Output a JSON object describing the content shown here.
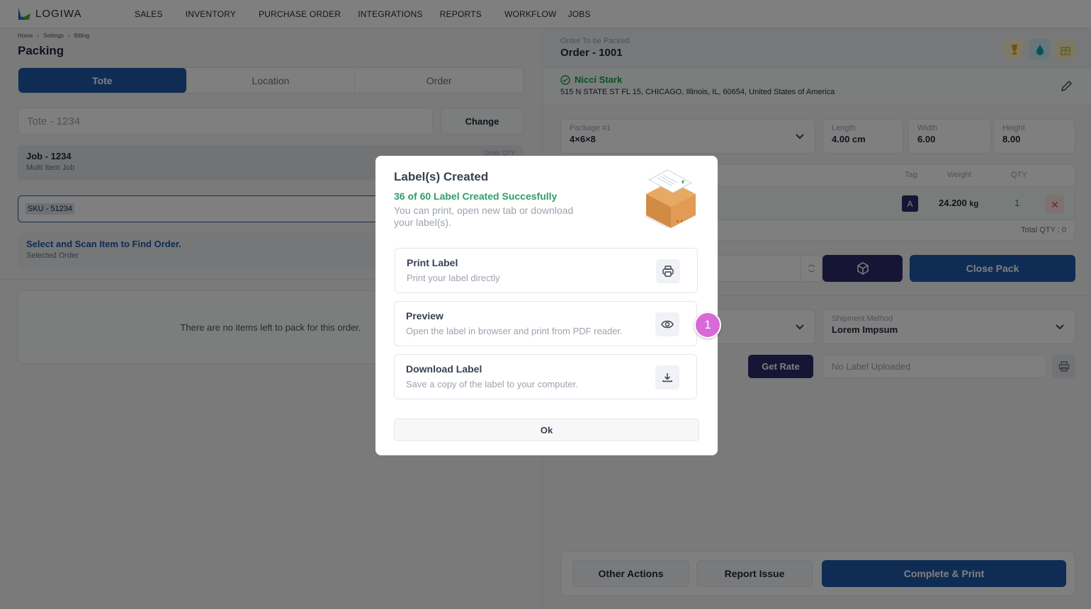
{
  "app": {
    "logo_text": "LOGIWA",
    "nav": [
      "SALES",
      "INVENTORY",
      "PURCHASE ORDER",
      "INTEGRATIONS",
      "REPORTS",
      "WORKFLOW",
      "JOBS"
    ]
  },
  "left": {
    "breadcrumb": [
      "Home",
      "Settings",
      "Billing"
    ],
    "page_title": "Packing",
    "tabs": [
      {
        "label": "Tote",
        "active": true
      },
      {
        "label": "Location",
        "active": false
      },
      {
        "label": "Order",
        "active": false
      }
    ],
    "tote_input_value": "Tote - 1234",
    "change_label": "Change",
    "job": {
      "title": "Job - 1234",
      "subtitle": "Multi Item Job",
      "qty_label": "Order QTY"
    },
    "sku_value": "SKU - 51234",
    "scan": {
      "title": "Select and Scan Item to Find Order.",
      "subtitle": "Selected Order"
    },
    "empty_message": "There are no items left to pack for this order."
  },
  "right": {
    "order_label": "Order To be Packed",
    "order_number": "Order - 1001",
    "badges": [
      {
        "icon": "fragile-glass-icon",
        "color": "#e0a800"
      },
      {
        "icon": "water-drop-icon",
        "color": "#14b8c4"
      },
      {
        "icon": "gift-icon",
        "color": "#d4c44a"
      }
    ],
    "customer_name": "Nicci Stark",
    "customer_address": "515 N STATE ST FL 15, CHICAGO, Illinois, IL, 60654, United States of America",
    "package": {
      "label": "Package #1",
      "value": "4×6×8"
    },
    "length": {
      "label": "Length",
      "value": "4.00 cm"
    },
    "width": {
      "label": "Width",
      "value": "6.00"
    },
    "height": {
      "label": "Height",
      "value": "8.00"
    },
    "table_headers": {
      "tag": "Tag",
      "weight": "Weight",
      "qty": "QTY"
    },
    "item": {
      "tag": "A",
      "weight": "24.200",
      "weight_unit": "kg",
      "qty": "1"
    },
    "total_qty": "Total QTY : 0",
    "close_pack_label": "Close Pack",
    "shipment_method": {
      "label": "Shipment Method",
      "value": "Lorem Impsum"
    },
    "get_rate_label": "Get Rate",
    "label_upload_placeholder": "No Label Uploaded",
    "footer": {
      "other_actions": "Other Actions",
      "report_issue": "Report Issue",
      "complete_print": "Complete & Print"
    }
  },
  "modal": {
    "title": "Label(s) Created",
    "success": "36 of 60 Label Created Succesfully",
    "description": "You can print, open new tab or download your label(s).",
    "options": [
      {
        "title": "Print Label",
        "description": "Print your label directly",
        "icon": "printer-icon"
      },
      {
        "title": "Preview",
        "description": "Open the label in browser and print from PDF reader.",
        "icon": "eye-icon"
      },
      {
        "title": "Download Label",
        "description": "Save a copy of the label to your computer.",
        "icon": "download-icon"
      }
    ],
    "ok_label": "Ok"
  },
  "step_marker": "1"
}
